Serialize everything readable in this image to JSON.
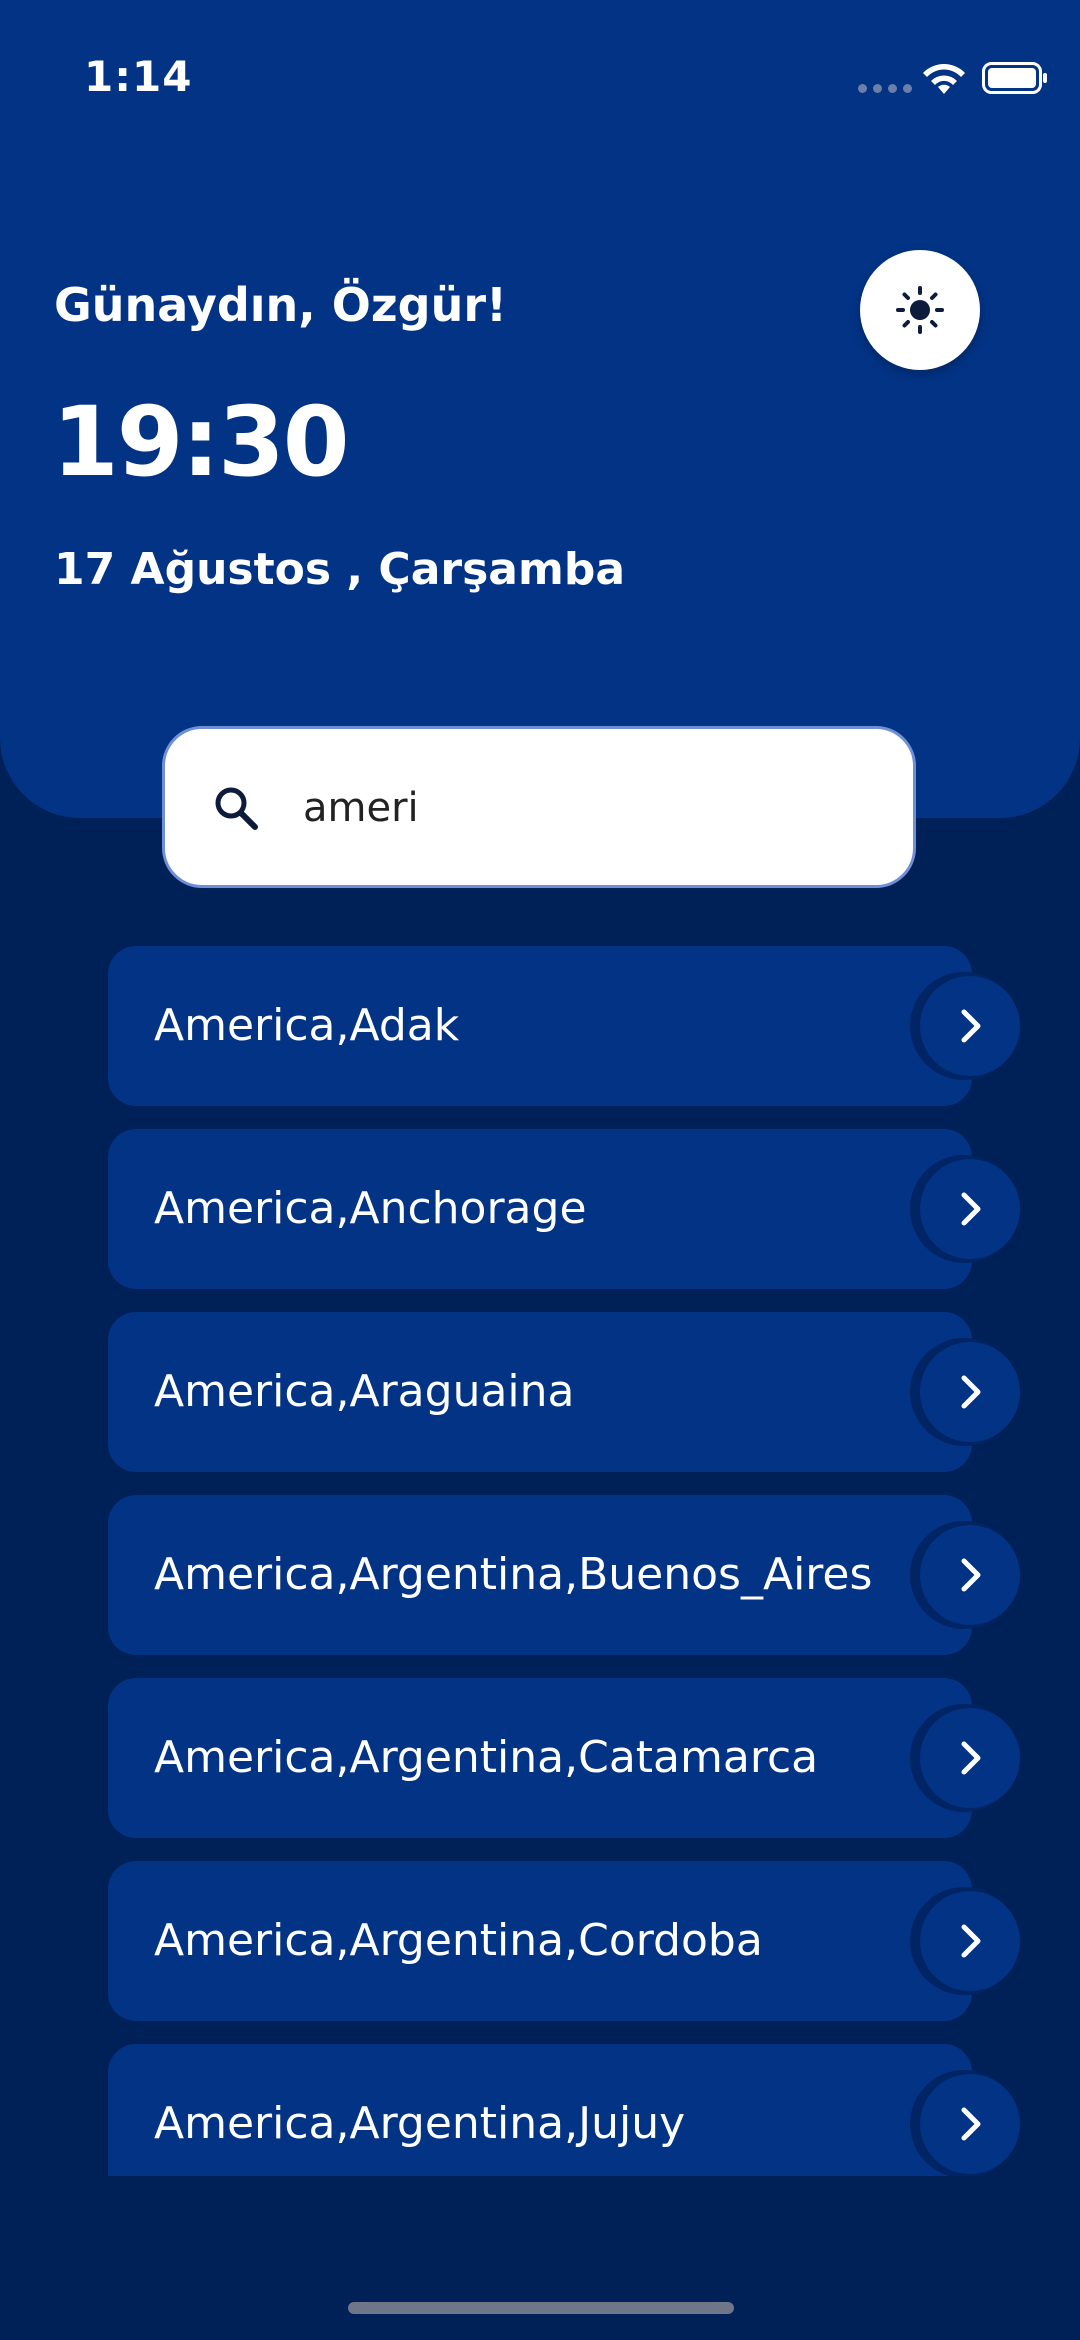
{
  "status_bar": {
    "time": "1:14",
    "signal_icon": "signal-dots-icon",
    "wifi_icon": "wifi-icon",
    "battery_icon": "battery-icon"
  },
  "header": {
    "greeting": "Günaydın, Özgür!",
    "clock": "19:30",
    "date": "17 Ağustos , Çarşamba",
    "theme_toggle_icon": "sun-icon"
  },
  "search": {
    "value": "ameri",
    "icon": "search-icon"
  },
  "results": [
    {
      "label": "America,Adak"
    },
    {
      "label": "America,Anchorage"
    },
    {
      "label": "America,Araguaina"
    },
    {
      "label": "America,Argentina,Buenos_Aires"
    },
    {
      "label": "America,Argentina,Catamarca"
    },
    {
      "label": "America,Argentina,Cordoba"
    },
    {
      "label": "America,Argentina,Jujuy"
    }
  ],
  "colors": {
    "background": "#002158",
    "header": "#033385",
    "card": "#033385",
    "text": "#ffffff"
  }
}
